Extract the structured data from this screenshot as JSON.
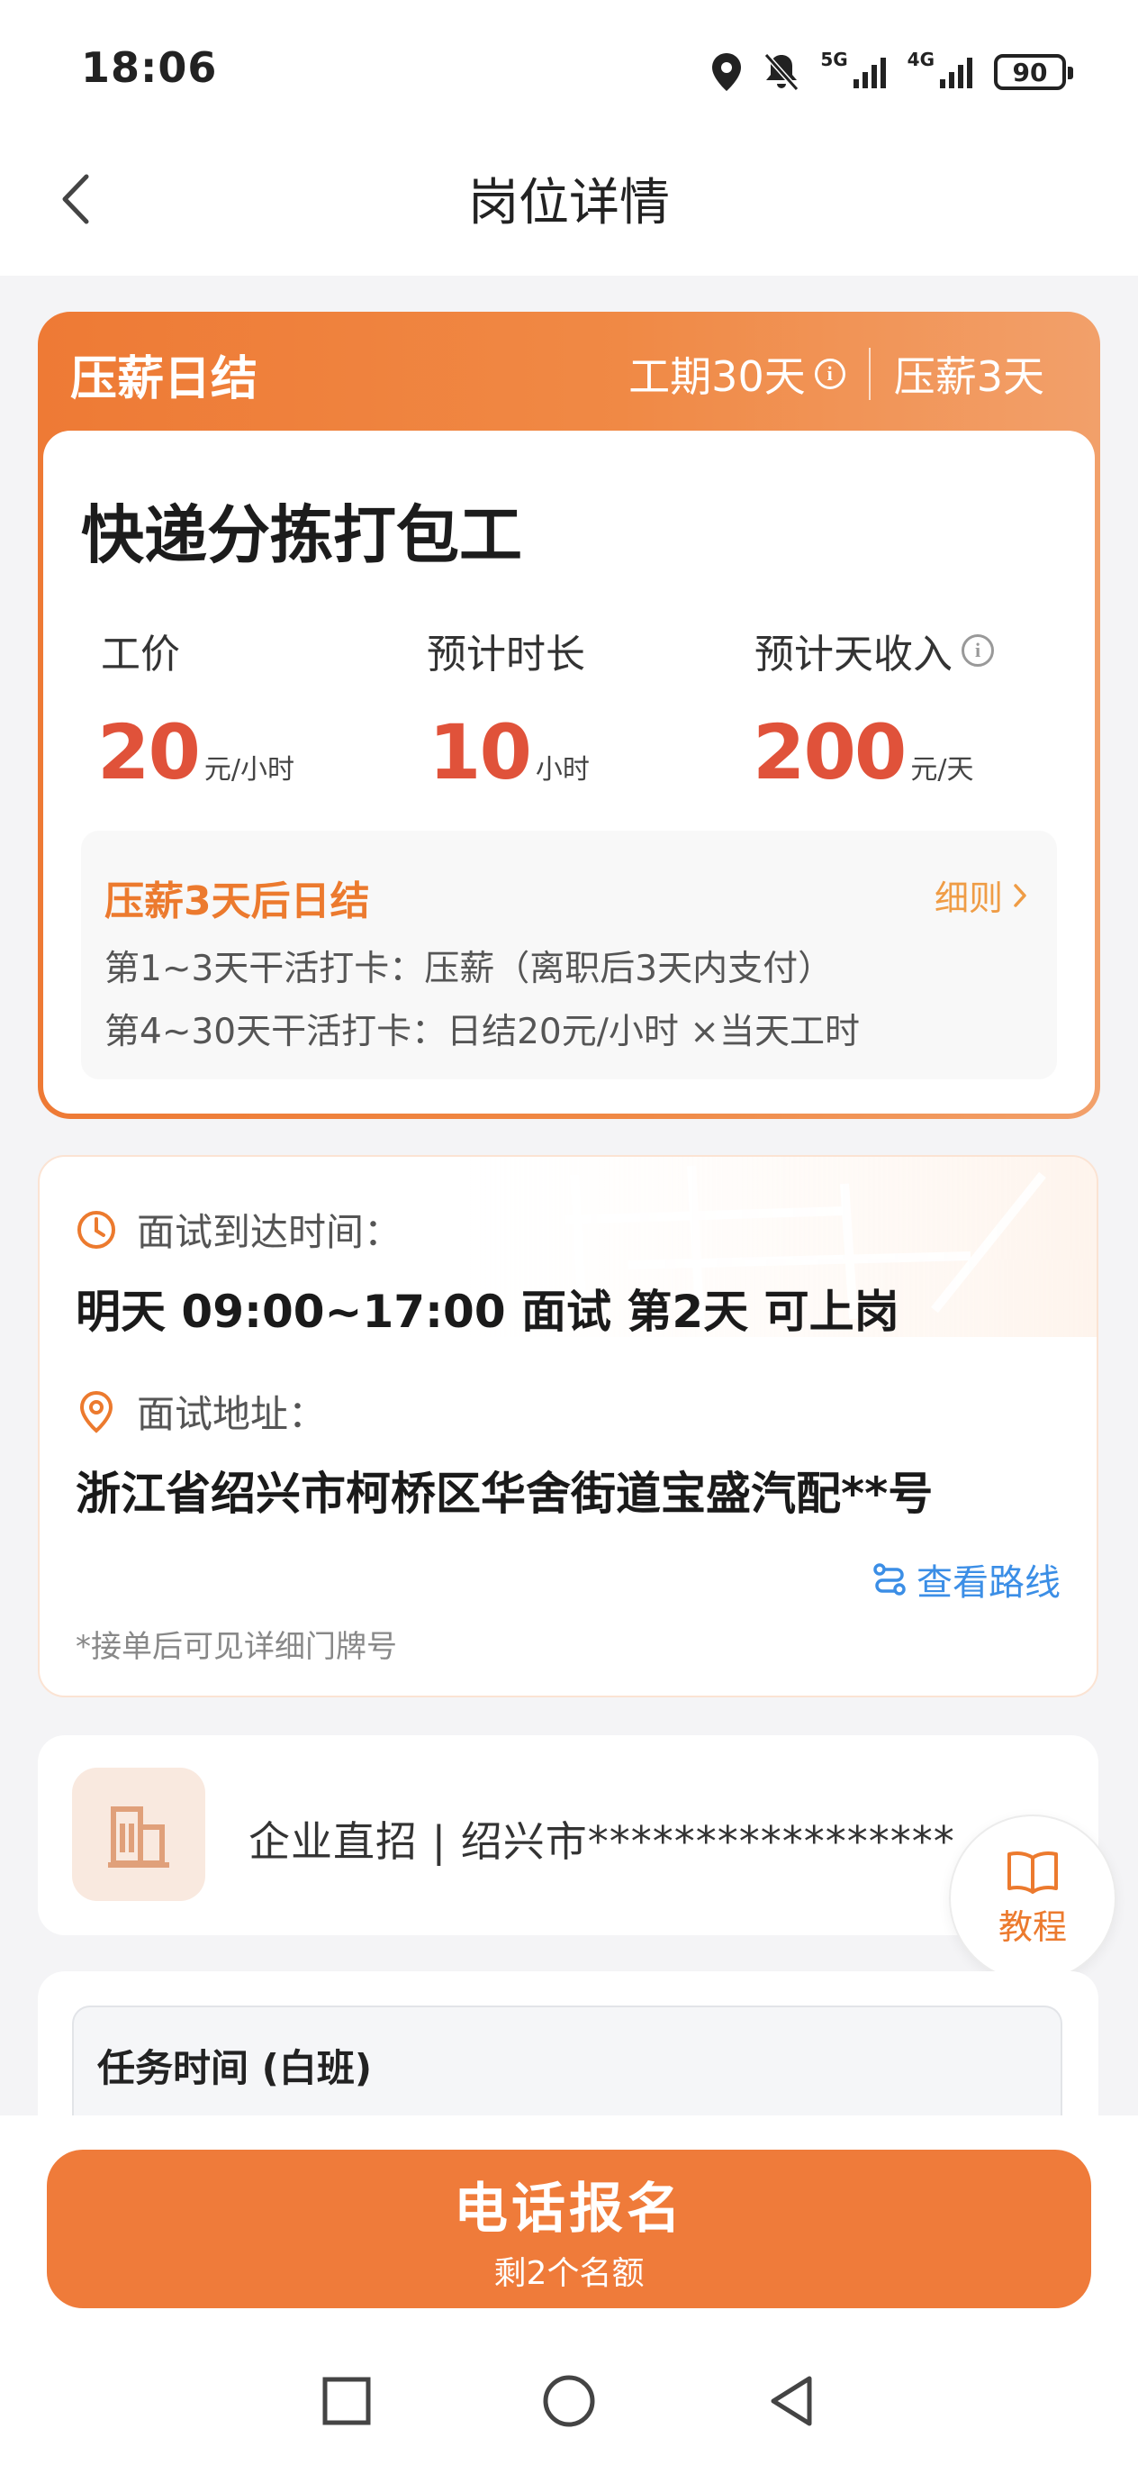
{
  "status_bar": {
    "time": "18:06",
    "signal1_label": "5G",
    "signal2_label": "4G",
    "battery": "90",
    "icons": [
      "location-icon",
      "mute-bell-icon",
      "signal-icon",
      "battery-icon"
    ]
  },
  "nav": {
    "title": "岗位详情",
    "back_icon": "chevron-left-icon"
  },
  "salary_card": {
    "tag": "压薪日结",
    "period": "工期30天",
    "hold": "压薪3天",
    "job_title": "快递分拣打包工",
    "stats": [
      {
        "label": "工价",
        "value": "20",
        "unit": "元/小时"
      },
      {
        "label": "预计时长",
        "value": "10",
        "unit": "小时"
      },
      {
        "label": "预计天收入",
        "value": "200",
        "unit": "元/天"
      }
    ],
    "rule": {
      "title": "压薪3天后日结",
      "link": "细则",
      "lines": [
        "第1~3天干活打卡：压薪（离职后3天内支付）",
        "第4~30天干活打卡：日结20元/小时 ×当天工时"
      ]
    }
  },
  "interview": {
    "time_label": "面试到达时间：",
    "time_value": "明天 09:00~17:00 面试 第2天 可上岗",
    "address_label": "面试地址：",
    "address_value": "浙江省绍兴市柯桥区华舍街道宝盛汽配**号",
    "route_link": "查看路线",
    "note": "*接单后可见详细门牌号"
  },
  "company": {
    "text": "企业直招 | 绍兴市*****************",
    "tutorial_label": "教程"
  },
  "task": {
    "title": "任务时间 (白班)"
  },
  "apply": {
    "main": "电话报名",
    "sub": "剩2个名额"
  },
  "colors": {
    "accent": "#ef7b3a",
    "price_red": "#e0523a",
    "link_blue": "#3b8ee6"
  }
}
